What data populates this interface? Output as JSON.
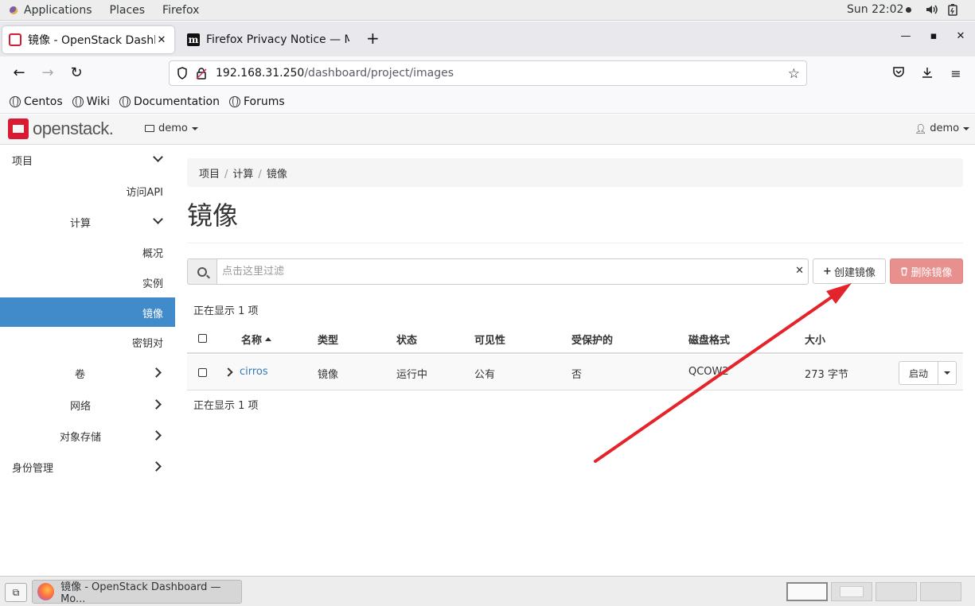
{
  "topbar": {
    "applications": "Applications",
    "places": "Places",
    "firefox": "Firefox",
    "clock": "Sun 22:02"
  },
  "browser": {
    "tabs": [
      {
        "title": "镜像 - OpenStack Dashbo",
        "active": true
      },
      {
        "title": "Firefox Privacy Notice — M",
        "active": false
      }
    ],
    "url_host": "192.168.31.250",
    "url_path": "/dashboard/project/images",
    "bookmarks": [
      "Centos",
      "Wiki",
      "Documentation",
      "Forums"
    ]
  },
  "header": {
    "logo_text": "openstack.",
    "project": "demo",
    "user": "demo"
  },
  "sidebar": {
    "items": [
      {
        "label": "项目",
        "chevron": "down"
      },
      {
        "label": "访问API"
      },
      {
        "label": "计算",
        "chevron": "down"
      },
      {
        "label": "概况"
      },
      {
        "label": "实例"
      },
      {
        "label": "镜像",
        "active": true
      },
      {
        "label": "密钥对"
      },
      {
        "label": "卷",
        "chevron": "right"
      },
      {
        "label": "网络",
        "chevron": "right"
      },
      {
        "label": "对象存储",
        "chevron": "right"
      },
      {
        "label": "身份管理",
        "chevron": "right"
      }
    ]
  },
  "main": {
    "breadcrumb": [
      "项目",
      "计算",
      "镜像"
    ],
    "title": "镜像",
    "filter_placeholder": "点击这里过滤",
    "create_button": "创建镜像",
    "delete_button": "删除镜像",
    "count_text": "正在显示 1 项",
    "columns": [
      "名称",
      "类型",
      "状态",
      "可见性",
      "受保护的",
      "磁盘格式",
      "大小"
    ],
    "rows": [
      {
        "name": "cirros",
        "type": "镜像",
        "status": "运行中",
        "visibility": "公有",
        "protected": "否",
        "disk_format": "QCOW2",
        "size": "273 字节",
        "action": "启动"
      }
    ]
  },
  "taskbar": {
    "task": "镜像 - OpenStack Dashboard — Mo..."
  },
  "colors": {
    "accent": "#428bca",
    "openstack_red": "#da1a32",
    "danger": "#e8908e",
    "annotation_arrow": "#e3242b"
  }
}
